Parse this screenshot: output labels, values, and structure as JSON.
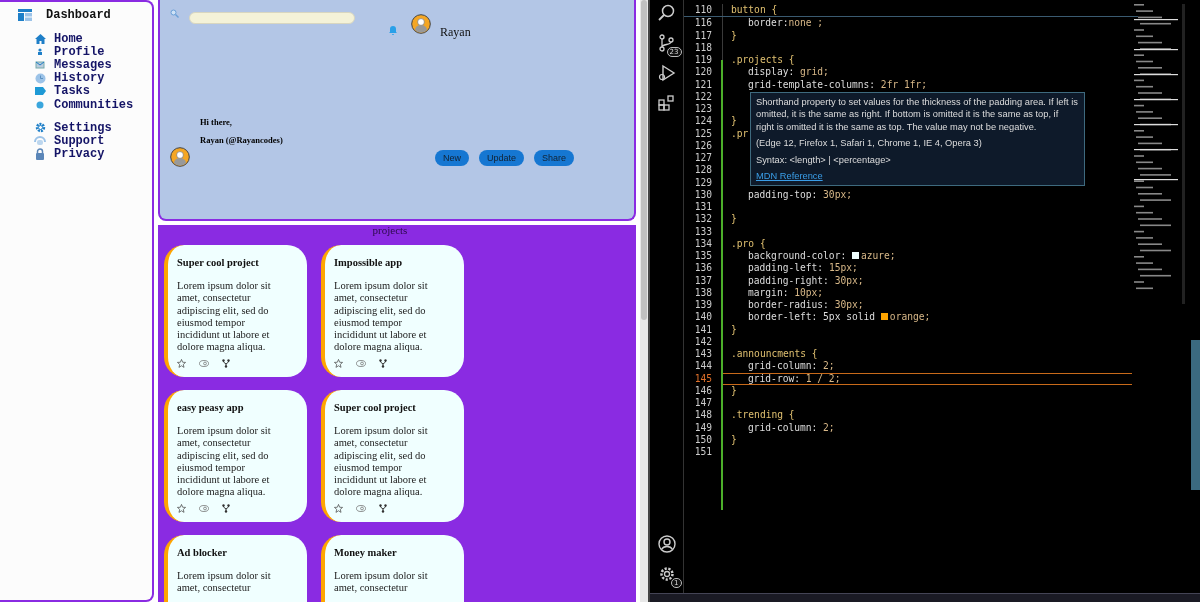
{
  "browser": {
    "sidebar": {
      "title": "Dashboard",
      "groups": [
        [
          {
            "label": "Home"
          },
          {
            "label": "Profile"
          },
          {
            "label": "Messages"
          },
          {
            "label": "History"
          },
          {
            "label": "Tasks"
          },
          {
            "label": "Communities"
          }
        ],
        [
          {
            "label": "Settings"
          },
          {
            "label": "Support"
          },
          {
            "label": "Privacy"
          }
        ]
      ]
    },
    "header": {
      "user_name": "Rayan",
      "greeting": "Hi there,",
      "handle": "Rayan (@Rayancodes)",
      "buttons": [
        "New",
        "Update",
        "Share"
      ]
    },
    "projects": {
      "title": "projects",
      "cards": [
        {
          "title": "Super cool project",
          "body": "Lorem ipsum dolor sit amet, consectetur adipiscing elit, sed do eiusmod tempor incididunt ut labore et dolore magna aliqua."
        },
        {
          "title": "Impossible app",
          "body": "Lorem ipsum dolor sit amet, consectetur adipiscing elit, sed do eiusmod tempor incididunt ut labore et dolore magna aliqua."
        },
        {
          "title": "easy peasy app",
          "body": "Lorem ipsum dolor sit amet, consectetur adipiscing elit, sed do eiusmod tempor incididunt ut labore et dolore magna aliqua."
        },
        {
          "title": "Super cool project",
          "body": "Lorem ipsum dolor sit amet, consectetur adipiscing elit, sed do eiusmod tempor incididunt ut labore et dolore magna aliqua."
        },
        {
          "title": "Ad blocker",
          "body": "Lorem ipsum dolor sit amet, consectetur"
        },
        {
          "title": "Money maker",
          "body": "Lorem ipsum dolor sit amet, consectetur"
        }
      ]
    }
  },
  "editor": {
    "activity_bar": {
      "source_control_badge": "23",
      "settings_badge": "1"
    },
    "sticky": {
      "n": "110",
      "kind": "selector",
      "code": "button {"
    },
    "lines": [
      {
        "n": "116",
        "kind": "decl",
        "prop": "border:",
        "value": "none ;",
        "current": false
      },
      {
        "n": "117",
        "kind": "brace",
        "code": "}",
        "current": false
      },
      {
        "n": "118",
        "kind": "blank",
        "current": false
      },
      {
        "n": "119",
        "kind": "selector",
        "code": ".projects {",
        "current": false
      },
      {
        "n": "120",
        "kind": "decl",
        "prop": "display: ",
        "value": "grid;",
        "current": false
      },
      {
        "n": "121",
        "kind": "decl",
        "prop": "grid-template-columns: ",
        "value": "2fr 1fr;",
        "current": false
      },
      {
        "n": "122",
        "kind": "blank",
        "current": false
      },
      {
        "n": "123",
        "kind": "blank",
        "current": false
      },
      {
        "n": "124",
        "kind": "brace",
        "code": "}",
        "current": false
      },
      {
        "n": "125",
        "kind": "selector",
        "code": ".pr",
        "current": false
      },
      {
        "n": "126",
        "kind": "blank",
        "current": false
      },
      {
        "n": "127",
        "kind": "blank",
        "current": false
      },
      {
        "n": "128",
        "kind": "blank",
        "current": false
      },
      {
        "n": "129",
        "kind": "blank",
        "current": false
      },
      {
        "n": "130",
        "kind": "decl",
        "prop": "padding-top: ",
        "value": "30px;",
        "current": false
      },
      {
        "n": "131",
        "kind": "blank",
        "current": false
      },
      {
        "n": "132",
        "kind": "brace",
        "code": "}",
        "current": false
      },
      {
        "n": "133",
        "kind": "blank",
        "current": false
      },
      {
        "n": "134",
        "kind": "selector",
        "code": ".pro {",
        "current": false
      },
      {
        "n": "135",
        "kind": "decl",
        "prop": "background-color: ",
        "color": "#f0ffff",
        "value": "azure;",
        "current": false
      },
      {
        "n": "136",
        "kind": "decl",
        "prop": "padding-left: ",
        "value": "15px;",
        "current": false
      },
      {
        "n": "137",
        "kind": "decl",
        "prop": "padding-right: ",
        "value": "30px;",
        "current": false
      },
      {
        "n": "138",
        "kind": "decl",
        "prop": "margin: ",
        "value": "10px;",
        "current": false
      },
      {
        "n": "139",
        "kind": "decl",
        "prop": "border-radius: ",
        "value": "30px;",
        "current": false
      },
      {
        "n": "140",
        "kind": "decl",
        "prop": "border-left: 5px solid ",
        "color": "#ffa500",
        "value": "orange;",
        "current": false
      },
      {
        "n": "141",
        "kind": "brace",
        "code": "}",
        "current": false
      },
      {
        "n": "142",
        "kind": "blank",
        "current": false
      },
      {
        "n": "143",
        "kind": "selector",
        "code": ".announcments {",
        "current": false
      },
      {
        "n": "144",
        "kind": "decl",
        "prop": "grid-column: ",
        "value": "2;",
        "current": false
      },
      {
        "n": "145",
        "kind": "decl",
        "prop": "grid-row: ",
        "value": "1 / 2;",
        "current": true
      },
      {
        "n": "146",
        "kind": "brace",
        "code": "}",
        "current": false
      },
      {
        "n": "147",
        "kind": "blank",
        "current": false
      },
      {
        "n": "148",
        "kind": "selector",
        "code": ".trending {",
        "current": false
      },
      {
        "n": "149",
        "kind": "decl",
        "prop": "grid-column: ",
        "value": "2;",
        "current": false
      },
      {
        "n": "150",
        "kind": "brace",
        "code": "}",
        "current": false
      },
      {
        "n": "151",
        "kind": "blank",
        "current": false
      }
    ],
    "tooltip": {
      "text": "Shorthand property to set values for the thickness of the padding area. If left is omitted, it is the same as right. If bottom is omitted it is the same as top, if right is omitted it is the same as top. The value may not be negative.",
      "compat": "(Edge 12, Firefox 1, Safari 1, Chrome 1, IE 4, Opera 3)",
      "syntax": "Syntax: <length> | <percentage>",
      "link": "MDN Reference"
    }
  }
}
